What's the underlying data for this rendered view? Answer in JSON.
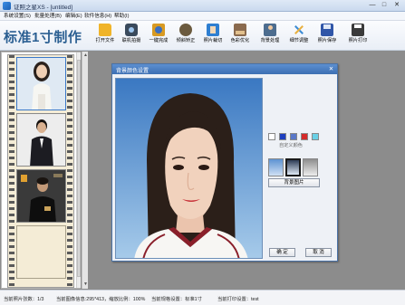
{
  "window": {
    "title": "证照之星XS - [untitled]",
    "controls": {
      "minimize": "—",
      "maximize": "□",
      "close": "✕"
    }
  },
  "menu": [
    {
      "label": "系统设置(S)"
    },
    {
      "label": "批量处理(B)"
    },
    {
      "label": "编辑(E)"
    },
    {
      "label": "软件信息(H)"
    },
    {
      "label": "帮助(I)"
    }
  ],
  "brand": "标准1寸制作",
  "toolbar": {
    "tools": [
      {
        "label": "打开文件",
        "icon": "folder-icon",
        "color": "#f0b429"
      },
      {
        "label": "联机拍摄",
        "icon": "camera-icon",
        "color": "#3a4a5c"
      },
      {
        "label": "一键完成",
        "icon": "one-click-icon",
        "color": "#d89a22"
      },
      {
        "label": "倾斜矫正",
        "icon": "tilt-correct-icon",
        "color": "#6b5a3e"
      },
      {
        "label": "照片裁切",
        "icon": "crop-icon",
        "color": "#2f7fd1"
      },
      {
        "label": "色彩优化",
        "icon": "color-optimize-icon",
        "color": "#8a6a4e"
      },
      {
        "label": "背景处理",
        "icon": "background-icon",
        "color": "#4d6d8f"
      },
      {
        "label": "细节调整",
        "icon": "detail-adjust-icon",
        "color": "#3a8ad4"
      },
      {
        "label": "照片保存",
        "icon": "save-icon",
        "color": "#3056a8"
      },
      {
        "label": "照片打印",
        "icon": "print-icon",
        "color": "#3a3a3a"
      }
    ]
  },
  "film": {
    "frames": [
      {
        "name": "photo-woman-white",
        "bg": "#dfe9f3",
        "cloth": "#f6f6f2",
        "hair": "#2a211c"
      },
      {
        "name": "photo-man-suit",
        "bg": "#e9e9e9",
        "cloth": "#1c1c22",
        "hair": "#16120f"
      },
      {
        "name": "photo-man-dark",
        "bg": "#2a2a2a",
        "cloth": "#0e0e0e",
        "hair": "#1a1410"
      }
    ]
  },
  "dialog": {
    "title": "背景颜色设置",
    "close": "✕",
    "custom_color_label": "自定义颜色",
    "swatches": [
      "#ffffff",
      "#1f3fbf",
      "#5a78c8",
      "#d42a2a",
      "#6ad0e6"
    ],
    "gradients": [
      "#7fb0e0",
      "#cfe0f4",
      "#b9b9b9"
    ],
    "pick_button": "背景图片",
    "ok_button": "确 定",
    "cancel_button": "取 消"
  },
  "status": {
    "photo_count": "当前照片张数：1/3",
    "info": "当前图像信息:295*413，缩放比例：100%",
    "spec": "当前规格设置：标准1寸",
    "print": "当前打印设置：test"
  }
}
